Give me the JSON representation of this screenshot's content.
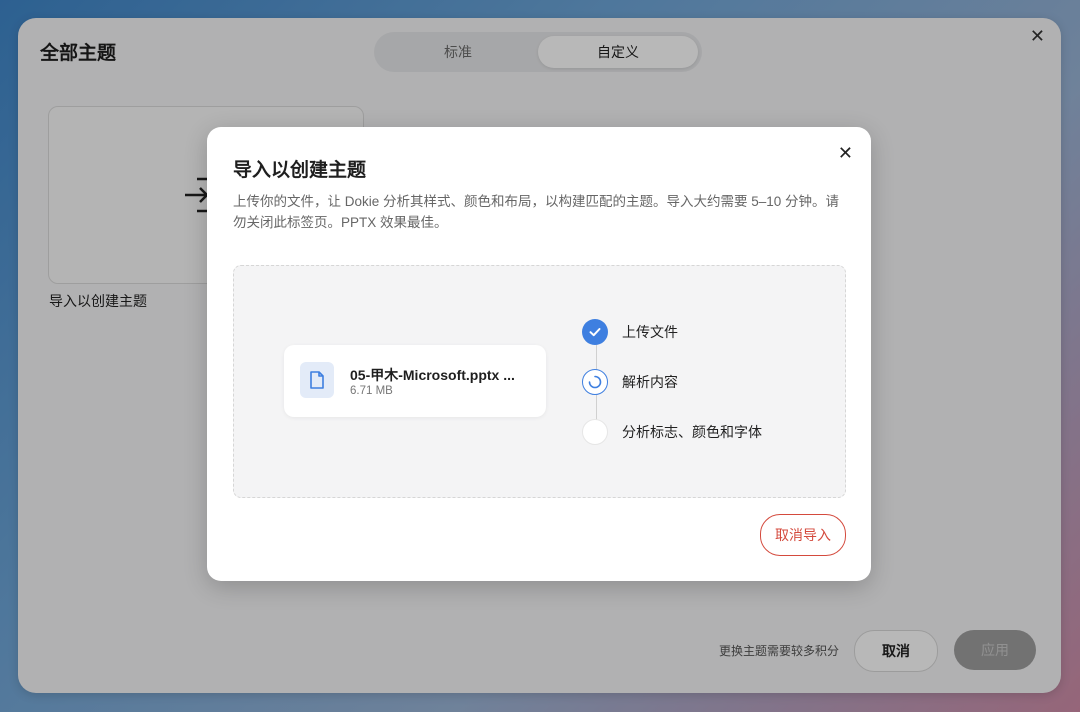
{
  "panel": {
    "title": "全部主题",
    "tabs": [
      {
        "label": "标准",
        "active": false
      },
      {
        "label": "自定义",
        "active": true
      }
    ],
    "close_icon": "close-icon",
    "import_card_label": "导入以创建主题",
    "footer_note": "更换主题需要较多积分",
    "cancel_label": "取消",
    "apply_label": "应用"
  },
  "dialog": {
    "title": "导入以创建主题",
    "description": "上传你的文件，让 Dokie 分析其样式、颜色和布局，以构建匹配的主题。导入大约需要 5–10 分钟。请勿关闭此标签页。PPTX 效果最佳。",
    "file": {
      "name": "05-甲木-Microsoft.pptx ...",
      "size": "6.71 MB",
      "icon": "file-icon"
    },
    "steps": [
      {
        "label": "上传文件",
        "status": "done"
      },
      {
        "label": "解析内容",
        "status": "active"
      },
      {
        "label": "分析标志、颜色和字体",
        "status": "pending"
      }
    ],
    "cancel_import_label": "取消导入"
  },
  "colors": {
    "accent": "#3e7fe0",
    "danger": "#d44a3d"
  }
}
